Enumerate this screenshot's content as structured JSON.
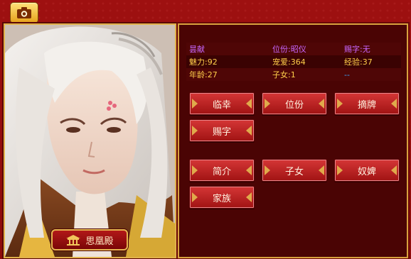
{
  "header": {
    "camera_icon": "camera-icon"
  },
  "portrait": {
    "palace_label": "思凰殿",
    "palace_icon": "pavilion-icon"
  },
  "stats": {
    "name": "昙献",
    "rank": "位份:昭仪",
    "title_award": "赐字:无",
    "charm": "魅力:92",
    "favor": "宠爱:364",
    "exp": "经验:37",
    "age": "年龄:27",
    "children": "子女:1",
    "extra": "--"
  },
  "buttons": {
    "summon": "临幸",
    "rank": "位份",
    "remove_tag": "摘牌",
    "grant_name": "赐字",
    "intro": "简介",
    "children": "子女",
    "servants": "奴婢",
    "family": "家族"
  },
  "colors": {
    "background": "#9a0d0d",
    "panel": "#4a0404",
    "gold_border": "#d8a23e",
    "name_purple": "#c667ff",
    "stat_gold": "#ffcf4a",
    "stat_blue": "#39a8ff"
  }
}
